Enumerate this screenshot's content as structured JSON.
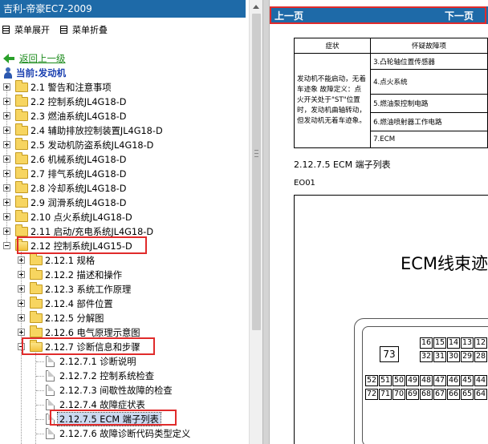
{
  "window": {
    "title": "吉利-帝豪EC7-2009"
  },
  "toolbar": {
    "expand_label": "菜单展开",
    "collapse_label": "菜单折叠"
  },
  "nav": {
    "back_label": "返回上一级",
    "current_label": "当前:发动机"
  },
  "tree": {
    "items": [
      {
        "label": "2.1 警告和注意事项"
      },
      {
        "label": "2.2 控制系统JL4G18-D"
      },
      {
        "label": "2.3 燃油系统JL4G18-D"
      },
      {
        "label": "2.4 辅助排放控制装置JL4G18-D"
      },
      {
        "label": "2.5 发动机防盗系统JL4G18-D"
      },
      {
        "label": "2.6 机械系统JL4G18-D"
      },
      {
        "label": "2.7 排气系统JL4G18-D"
      },
      {
        "label": "2.8 冷却系统JL4G18-D"
      },
      {
        "label": "2.9 润滑系统JL4G18-D"
      },
      {
        "label": "2.10 点火系统JL4G18-D"
      },
      {
        "label": "2.11 启动/充电系统JL4G18-D"
      },
      {
        "label": "2.12 控制系统JL4G15-D"
      }
    ],
    "sub": [
      {
        "label": "2.12.1 规格"
      },
      {
        "label": "2.12.2 描述和操作"
      },
      {
        "label": "2.12.3 系统工作原理"
      },
      {
        "label": "2.12.4 部件位置"
      },
      {
        "label": "2.12.5 分解图"
      },
      {
        "label": "2.12.6 电气原理示意图"
      },
      {
        "label": "2.12.7 诊断信息和步骤"
      }
    ],
    "leaves": [
      {
        "label": "2.12.7.1 诊断说明"
      },
      {
        "label": "2.12.7.2 控制系统检查"
      },
      {
        "label": "2.12.7.3 间歇性故障的检查"
      },
      {
        "label": "2.12.7.4 故障症状表"
      },
      {
        "label": "2.12.7.5 ECM 端子列表"
      },
      {
        "label": "2.12.7.6 故障诊断代码类型定义"
      }
    ]
  },
  "content": {
    "prev_label": "上一页",
    "next_label": "下一页",
    "fault_table": {
      "header_symptom": "症状",
      "header_cause": "怀疑故障项",
      "symptom_text": "发动机不能启动，无着车迹象 故障定义：点火开关处于\"ST\"位置时，发动机曲轴转动，但发动机无着车迹象。",
      "causes": [
        "3.凸轮轴位置传感器",
        "4.点火系统",
        "5.燃油泵控制电路",
        "6.燃油喷射器工作电路",
        "7.ECM"
      ]
    },
    "section_title": "2.12.7.5 ECM 端子列表",
    "section_code": "EO01",
    "diagram_title": "ECM线束迹",
    "pin_main": "73",
    "pin_rows": [
      [
        "16",
        "15",
        "14",
        "13",
        "12"
      ],
      [
        "32",
        "31",
        "30",
        "29",
        "28"
      ],
      [
        "52",
        "51",
        "50",
        "49",
        "48",
        "47",
        "46",
        "45",
        "44"
      ],
      [
        "72",
        "71",
        "70",
        "69",
        "68",
        "67",
        "66",
        "65",
        "64"
      ]
    ]
  }
}
